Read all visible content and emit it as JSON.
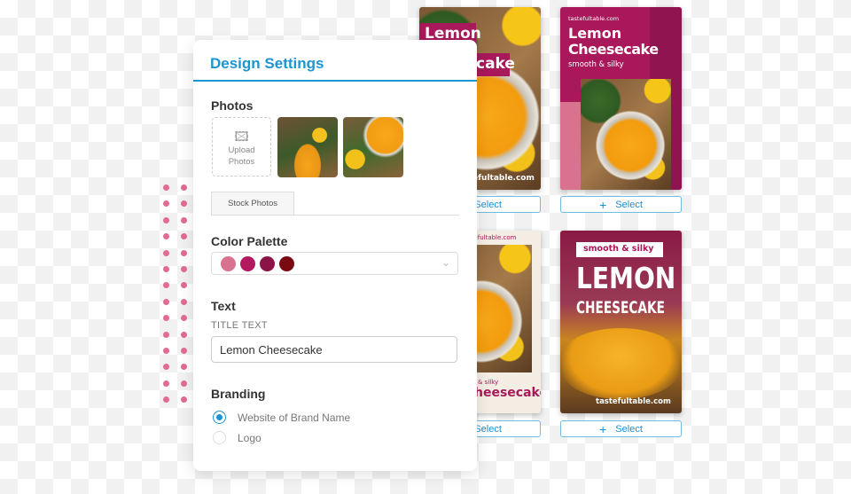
{
  "panel": {
    "title": "Design Settings",
    "photos": {
      "heading": "Photos",
      "upload_label_1": "Upload",
      "upload_label_2": "Photos",
      "stock_tab": "Stock Photos"
    },
    "color_palette": {
      "heading": "Color Palette",
      "swatches": [
        "#d9728e",
        "#b3195f",
        "#8c1345",
        "#7a0a12"
      ]
    },
    "text": {
      "heading": "Text",
      "field_label": "TITLE TEXT",
      "title_value": "Lemon Cheesecake"
    },
    "branding": {
      "heading": "Branding",
      "options": [
        {
          "label": "Website of Brand Name",
          "selected": true
        },
        {
          "label": "Logo",
          "selected": false
        }
      ]
    }
  },
  "cards": [
    {
      "title_1": "Lemon",
      "title_2": "cake",
      "site": "tastefultable.com",
      "select": "Select"
    },
    {
      "site": "tastefultable.com",
      "title_1": "Lemon",
      "title_2": "Cheesecake",
      "subtitle": "smooth & silky",
      "select": "Select"
    },
    {
      "site": "tastefultable.com",
      "subtitle": "& silky",
      "title_2": "heesecake",
      "select": "Select"
    },
    {
      "subtitle": "smooth & silky",
      "title_1": "LEMON",
      "title_2": "CHEESECAKE",
      "site": "tastefultable.com",
      "select": "Select"
    }
  ],
  "colors": {
    "accent": "#1c95d2",
    "brand": "#a8185a"
  }
}
